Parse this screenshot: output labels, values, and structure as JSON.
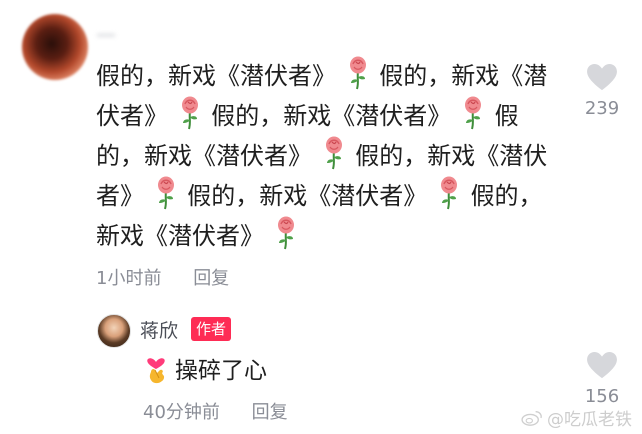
{
  "comment": {
    "username": "—",
    "segments": [
      "假的，新戏《潜伏者》",
      "rose",
      "假的，新戏《潜伏者》",
      "rose",
      "假的，新戏《潜伏者》",
      "rose",
      "假的，新戏《潜伏者》",
      "rose",
      "假的，新戏《潜伏者》",
      "rose",
      "假的，新戏《潜伏者》",
      "rose",
      "假的，新戏《潜伏者》",
      "rose"
    ],
    "time": "1小时前",
    "reply_label": "回复",
    "likes": "239"
  },
  "reply": {
    "username": "蒋欣",
    "badge": "作者",
    "text": "操碎了心",
    "time": "40分钟前",
    "reply_label": "回复",
    "likes": "156"
  },
  "icons": {
    "rose": "rose-emoji-icon",
    "heart_hands": "finger-heart-emoji-icon",
    "like": "heart-icon"
  },
  "colors": {
    "badge": "#fe2c55",
    "meta": "#8a8d96",
    "heart": "#d6d7db"
  },
  "watermark": "@吃瓜老铁"
}
